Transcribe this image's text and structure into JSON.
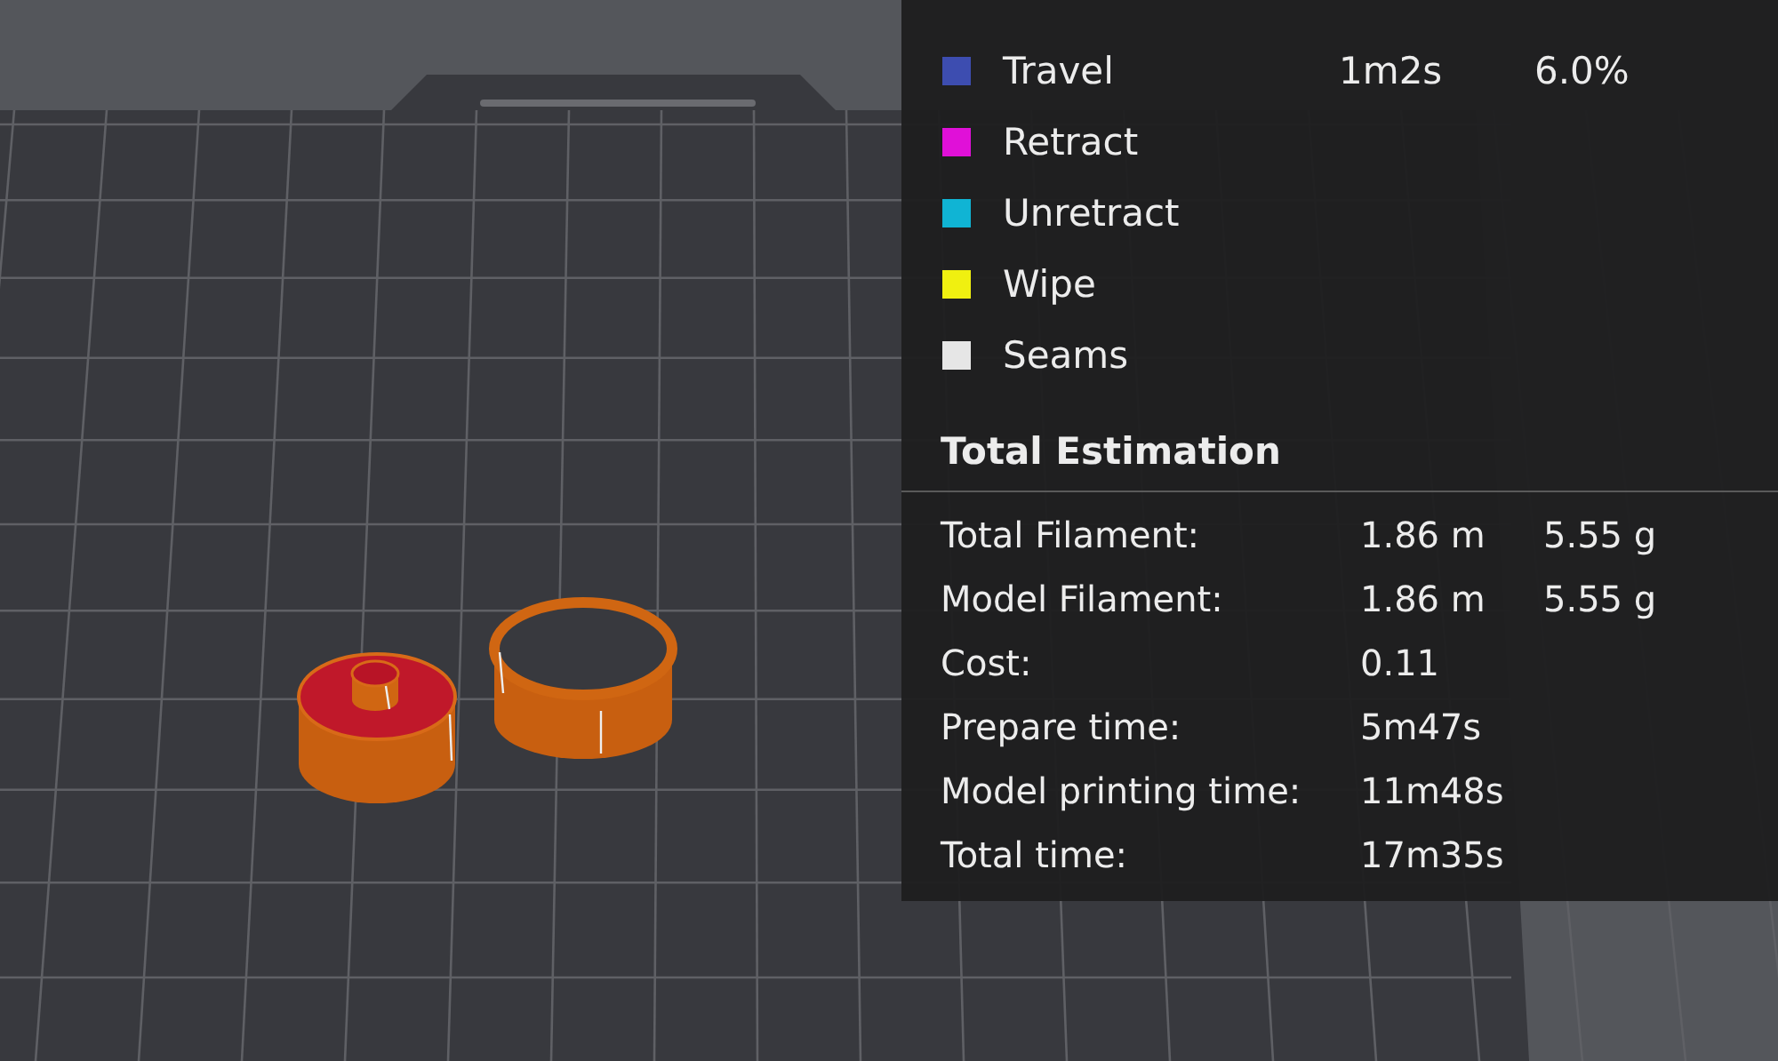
{
  "legend": [
    {
      "label": "Travel",
      "color": "#3d4db0",
      "time": "1m2s",
      "percent": "6.0%"
    },
    {
      "label": "Retract",
      "color": "#e010d8"
    },
    {
      "label": "Unretract",
      "color": "#10b4d4"
    },
    {
      "label": "Wipe",
      "color": "#f0f010"
    },
    {
      "label": "Seams",
      "color": "#e6e6e6"
    }
  ],
  "total_estimation": {
    "title": "Total Estimation",
    "rows": [
      {
        "label": "Total Filament:",
        "values": [
          "1.86 m",
          "5.55 g"
        ]
      },
      {
        "label": "Model Filament:",
        "values": [
          "1.86 m",
          "5.55 g"
        ]
      },
      {
        "label": "Cost:",
        "values": [
          "0.11"
        ]
      },
      {
        "label": "Prepare time:",
        "values": [
          "5m47s"
        ]
      },
      {
        "label": "Model printing time:",
        "values": [
          "11m48s"
        ]
      },
      {
        "label": "Total time:",
        "values": [
          "17m35s"
        ]
      }
    ]
  }
}
